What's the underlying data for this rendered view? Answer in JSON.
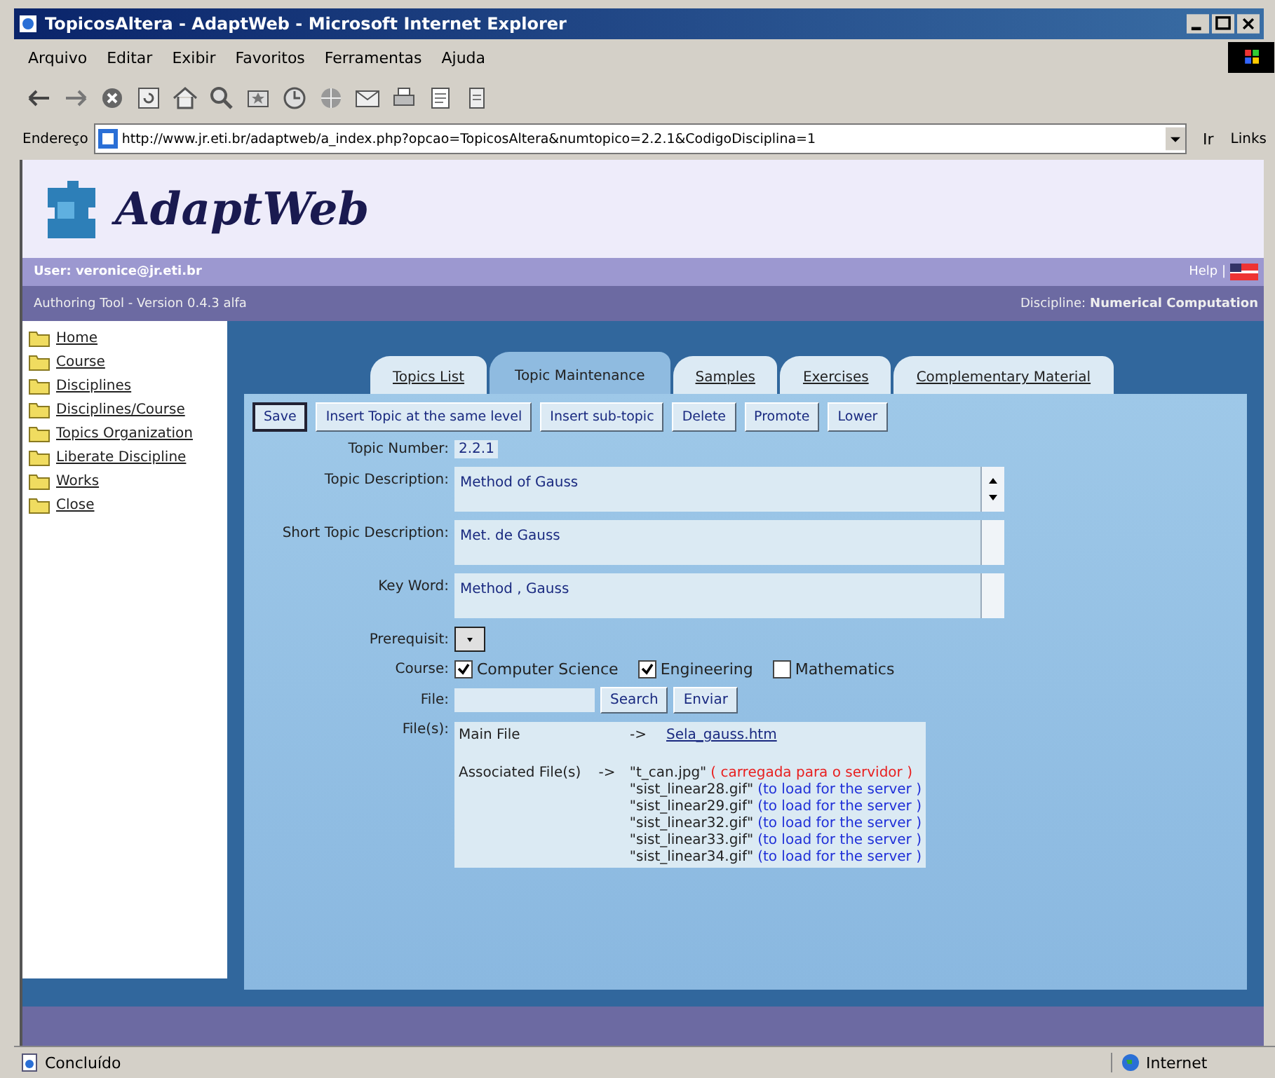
{
  "window": {
    "title": "TopicosAltera - AdaptWeb - Microsoft Internet Explorer"
  },
  "menu": [
    "Arquivo",
    "Editar",
    "Exibir",
    "Favoritos",
    "Ferramentas",
    "Ajuda"
  ],
  "address": {
    "label": "Endereço",
    "url": "http://www.jr.eti.br/adaptweb/a_index.php?opcao=TopicosAltera&numtopico=2.2.1&CodigoDisciplina=1",
    "go": "Ir",
    "links": "Links"
  },
  "logo": {
    "name": "AdaptWeb"
  },
  "user_bar": {
    "user": "User: veronice@jr.eti.br",
    "help": "Help |"
  },
  "info_bar": {
    "version": "Authoring Tool - Version 0.4.3 alfa",
    "discipline_label": "Discipline:",
    "discipline": "Numerical Computation"
  },
  "sidebar": {
    "items": [
      "Home",
      "Course",
      "Disciplines",
      "Disciplines/Course",
      "Topics Organization",
      "Liberate Discipline",
      "Works",
      "Close"
    ]
  },
  "tabs": [
    {
      "label": "Topics List",
      "selected": false
    },
    {
      "label": "Topic Maintenance",
      "selected": true
    },
    {
      "label": "Samples",
      "selected": false
    },
    {
      "label": "Exercises",
      "selected": false
    },
    {
      "label": "Complementary Material",
      "selected": false
    }
  ],
  "buttons": [
    {
      "label": "Save",
      "focused": true
    },
    {
      "label": "Insert Topic at the same level",
      "focused": false
    },
    {
      "label": "Insert sub-topic",
      "focused": false
    },
    {
      "label": "Delete",
      "focused": false
    },
    {
      "label": "Promote",
      "focused": false
    },
    {
      "label": "Lower",
      "focused": false
    }
  ],
  "form": {
    "topic_number": {
      "label": "Topic Number:",
      "value": "2.2.1"
    },
    "fields": [
      {
        "label": "Topic Description:",
        "value": "Method of Gauss"
      },
      {
        "label": "Short Topic Description:",
        "value": "Met. de Gauss"
      },
      {
        "label": "Key Word:",
        "value": "Method , Gauss"
      }
    ],
    "prerequisite": {
      "label": "Prerequisit:"
    },
    "course": {
      "label": "Course:",
      "options": [
        {
          "label": "Computer Science",
          "checked": true
        },
        {
          "label": "Engineering",
          "checked": true
        },
        {
          "label": "Mathematics",
          "checked": false
        }
      ]
    },
    "file": {
      "label": "File:",
      "buttons": [
        "Search",
        "Enviar"
      ]
    },
    "files": {
      "label": "File(s):",
      "main_label": "Main File",
      "arrow": "->",
      "main_file": "Sela_gauss.htm",
      "assoc_label": "Associated File(s)",
      "assoc_arrow": "->",
      "associated": [
        {
          "file": "\"t_can.jpg\"",
          "status": "( carregada para o servidor )",
          "color": "#e82020"
        },
        {
          "file": "\"sist_linear28.gif\"",
          "status": "(to load for the server )",
          "color": "#2030d8"
        },
        {
          "file": "\"sist_linear29.gif\"",
          "status": "(to load for the server )",
          "color": "#2030d8"
        },
        {
          "file": "\"sist_linear32.gif\"",
          "status": "(to load for the server )",
          "color": "#2030d8"
        },
        {
          "file": "\"sist_linear33.gif\"",
          "status": "(to load for the server )",
          "color": "#2030d8"
        },
        {
          "file": "\"sist_linear34.gif\"",
          "status": "(to load for the server )",
          "color": "#2030d8"
        }
      ]
    }
  },
  "status_bar": {
    "text": "Concluído",
    "zone": "Internet"
  }
}
